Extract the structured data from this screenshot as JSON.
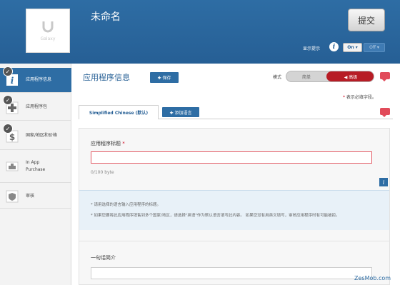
{
  "header": {
    "app_icon_brand": "Galaxy",
    "app_name": "未命名",
    "submit_label": "提交",
    "display_label": "显示提示",
    "toggle_on": "On ▾",
    "toggle_off": "Off ▾"
  },
  "sidebar": {
    "items": [
      {
        "label": "应用程序信息",
        "icon": "info-icon",
        "checked": true,
        "active": true
      },
      {
        "label": "应用程序包",
        "icon": "binary-package-icon",
        "checked": true,
        "active": false
      },
      {
        "label": "国家/地区和价格",
        "icon": "dollar-icon",
        "checked": true,
        "active": false
      },
      {
        "label": "In App Purchase",
        "icon": "in-app-purchase-icon",
        "checked": false,
        "active": false
      },
      {
        "label": "审核",
        "icon": "review-shield-icon",
        "checked": false,
        "active": false
      }
    ]
  },
  "main": {
    "page_title": "应用程序信息",
    "save_label": "✚ 保存",
    "mode_label": "模式",
    "mode_simple": "简单",
    "mode_advanced": "◀ 高级",
    "required_note": "表示必填字段。",
    "required_star": "*",
    "language_tab": "Simplified Chinese (默认)",
    "add_language": "✚ 添加语言",
    "title_field": {
      "label": "应用程序标题",
      "star": "*",
      "value": "",
      "byte_count": "0/100 byte"
    },
    "hints": [
      "* 请用选择的语言输入应用程序的标题。",
      "* 如果您要将此应用程序销售到多个国家/地区，请选择\"英语\"作为默认语言填写此内容。 如果您没有用英文填写，审核应用程序时有可能被拒。"
    ],
    "slogan_field": {
      "label": "一句话简介",
      "value": ""
    }
  },
  "watermark": "ZesMob.com",
  "colors": {
    "header_blue": "#2e6da4",
    "advanced_red": "#b71c25",
    "error_border": "#e35863",
    "hint_bg": "#e8f1f8"
  }
}
